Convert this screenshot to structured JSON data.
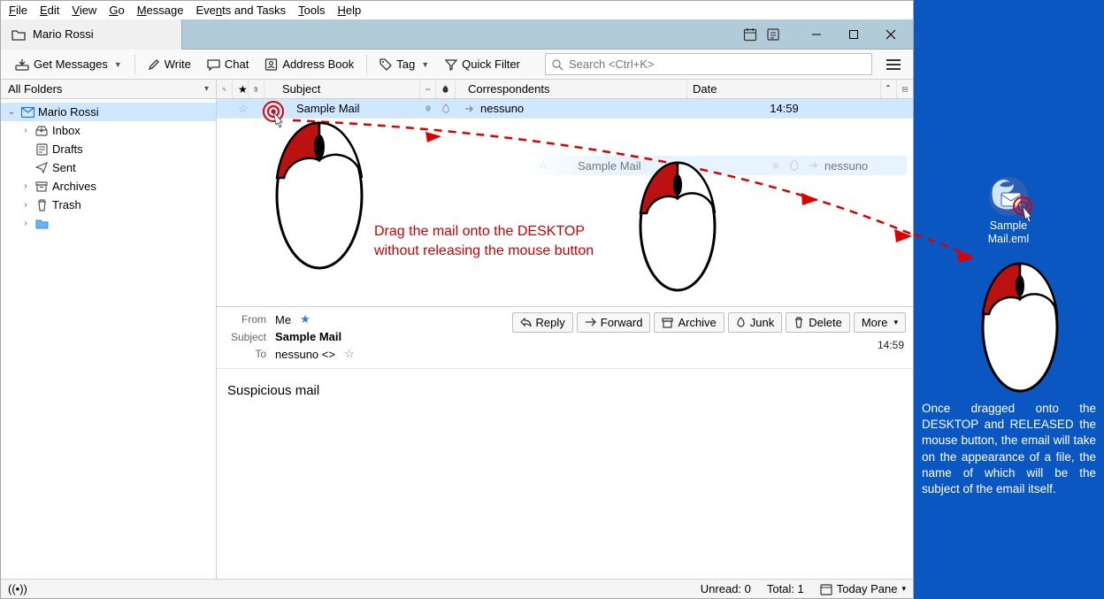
{
  "menu": {
    "file": "File",
    "edit": "Edit",
    "view": "View",
    "go": "Go",
    "message": "Message",
    "events": "Events and Tasks",
    "tools": "Tools",
    "help": "Help"
  },
  "tab": {
    "title": "Mario Rossi"
  },
  "toolbar": {
    "get": "Get Messages",
    "write": "Write",
    "chat": "Chat",
    "address": "Address Book",
    "tag": "Tag",
    "filter": "Quick Filter",
    "search_placeholder": "Search <Ctrl+K>"
  },
  "sidebar": {
    "header": "All Folders",
    "account": "Mario Rossi",
    "items": [
      "Inbox",
      "Drafts",
      "Sent",
      "Archives",
      "Trash"
    ]
  },
  "columns": {
    "subject": "Subject",
    "correspondents": "Correspondents",
    "date": "Date"
  },
  "row": {
    "subject": "Sample Mail",
    "correspondents": "nessuno",
    "date": "14:59"
  },
  "ghost": {
    "subject": "Sample Mail",
    "correspondents": "nessuno"
  },
  "preview": {
    "from_label": "From",
    "from": "Me",
    "subject_label": "Subject",
    "subject": "Sample Mail",
    "to_label": "To",
    "to": "nessuno <>",
    "time": "14:59",
    "body": "Suspicious mail"
  },
  "actions": {
    "reply": "Reply",
    "forward": "Forward",
    "archive": "Archive",
    "junk": "Junk",
    "delete": "Delete",
    "more": "More"
  },
  "status": {
    "unread": "Unread: 0",
    "total": "Total: 1",
    "today": "Today Pane"
  },
  "annotation": {
    "drag": "Drag the mail onto the DESKTOP\nwithout releasing the mouse button"
  },
  "desktop": {
    "filename": "Sample Mail.eml",
    "text": "Once dragged onto the DESKTOP and RELEASED the mouse button, the email will take on the appearance of a file, the name of which will be the subject of the email itself."
  }
}
